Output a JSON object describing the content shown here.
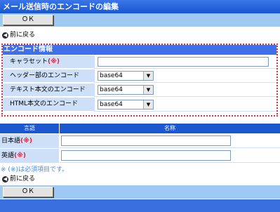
{
  "page": {
    "title": "メール送信時のエンコードの編集"
  },
  "toolbar": {
    "ok_label": "ＯＫ",
    "back_label": "前に戻る"
  },
  "encoding": {
    "section_title": "エンコード情報",
    "required_mark": "(※)",
    "rows": [
      {
        "label": "キャラセット",
        "required": true,
        "value": ""
      },
      {
        "label": "ヘッダー部のエンコード",
        "value": "base64"
      },
      {
        "label": "テキスト本文のエンコード",
        "value": "base64"
      },
      {
        "label": "HTML本文のエンコード",
        "value": "base64"
      }
    ]
  },
  "names": {
    "col_language": "言語",
    "col_name": "名称",
    "rows": [
      {
        "label": "日本語",
        "required_mark": "(※)",
        "value": ""
      },
      {
        "label": "英語",
        "required_mark": "(※)",
        "value": ""
      }
    ]
  },
  "note": "※ (※)は必須項目です。",
  "colors": {
    "title_bar": "#1a56d0",
    "button_bar": "#9ec9f3",
    "label_bg": "#cde0f8",
    "required": "#e0203a",
    "dotted_border": "#e0303c"
  }
}
